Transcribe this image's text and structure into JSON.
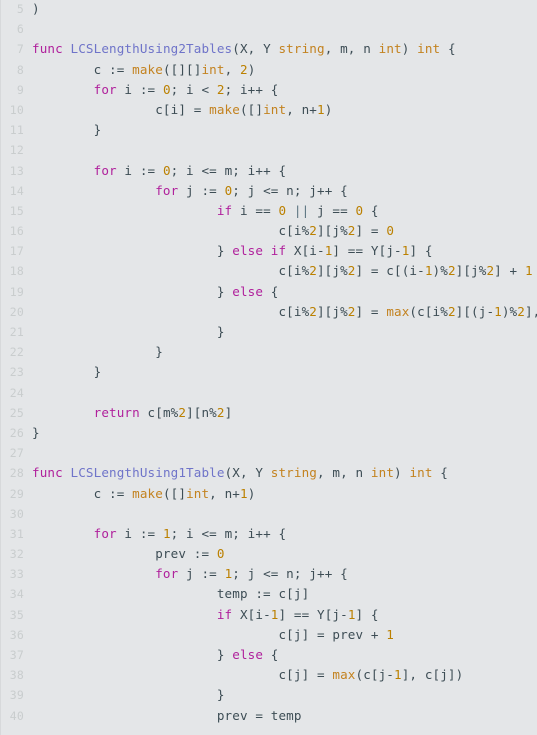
{
  "editor": {
    "language": "go",
    "background_color": "#e4e6e8",
    "gutter_color": "#c9cdce",
    "text_color": "#3d4d55",
    "first_visible_line": 5,
    "last_visible_line": 40,
    "theme_colors": {
      "keyword": "#b0219c",
      "function_name": "#6f74c9",
      "type_builtin": "#c3821f",
      "number": "#bb8000",
      "operator": "#5b7480",
      "plain": "#3d4d55"
    }
  },
  "lines": [
    {
      "number": "5",
      "tokens": [
        {
          "t": ")",
          "c": "t-pl"
        }
      ]
    },
    {
      "number": "6",
      "tokens": []
    },
    {
      "number": "7",
      "tokens": [
        {
          "t": "func ",
          "c": "t-kw"
        },
        {
          "t": "LCSLengthUsing2Tables",
          "c": "t-fn"
        },
        {
          "t": "(X, Y ",
          "c": "t-pl"
        },
        {
          "t": "string",
          "c": "t-type"
        },
        {
          "t": ", m, n ",
          "c": "t-pl"
        },
        {
          "t": "int",
          "c": "t-type"
        },
        {
          "t": ") ",
          "c": "t-pl"
        },
        {
          "t": "int",
          "c": "t-type"
        },
        {
          "t": " {",
          "c": "t-pl"
        }
      ]
    },
    {
      "number": "8",
      "tokens": [
        {
          "t": "        c := ",
          "c": "t-pl"
        },
        {
          "t": "make",
          "c": "t-type"
        },
        {
          "t": "([][]",
          "c": "t-pl"
        },
        {
          "t": "int",
          "c": "t-type"
        },
        {
          "t": ", ",
          "c": "t-pl"
        },
        {
          "t": "2",
          "c": "t-num"
        },
        {
          "t": ")",
          "c": "t-pl"
        }
      ]
    },
    {
      "number": "9",
      "tokens": [
        {
          "t": "        ",
          "c": "t-pl"
        },
        {
          "t": "for",
          "c": "t-kw"
        },
        {
          "t": " i := ",
          "c": "t-pl"
        },
        {
          "t": "0",
          "c": "t-num"
        },
        {
          "t": "; i < ",
          "c": "t-pl"
        },
        {
          "t": "2",
          "c": "t-num"
        },
        {
          "t": "; i++ {",
          "c": "t-pl"
        }
      ]
    },
    {
      "number": "10",
      "tokens": [
        {
          "t": "                c[i] = ",
          "c": "t-pl"
        },
        {
          "t": "make",
          "c": "t-type"
        },
        {
          "t": "([]",
          "c": "t-pl"
        },
        {
          "t": "int",
          "c": "t-type"
        },
        {
          "t": ", n+",
          "c": "t-pl"
        },
        {
          "t": "1",
          "c": "t-num"
        },
        {
          "t": ")",
          "c": "t-pl"
        }
      ]
    },
    {
      "number": "11",
      "tokens": [
        {
          "t": "        }",
          "c": "t-pl"
        }
      ]
    },
    {
      "number": "12",
      "tokens": []
    },
    {
      "number": "13",
      "tokens": [
        {
          "t": "        ",
          "c": "t-pl"
        },
        {
          "t": "for",
          "c": "t-kw"
        },
        {
          "t": " i := ",
          "c": "t-pl"
        },
        {
          "t": "0",
          "c": "t-num"
        },
        {
          "t": "; i <= m; i++ {",
          "c": "t-pl"
        }
      ]
    },
    {
      "number": "14",
      "tokens": [
        {
          "t": "                ",
          "c": "t-pl"
        },
        {
          "t": "for",
          "c": "t-kw"
        },
        {
          "t": " j := ",
          "c": "t-pl"
        },
        {
          "t": "0",
          "c": "t-num"
        },
        {
          "t": "; j <= n; j++ {",
          "c": "t-pl"
        }
      ]
    },
    {
      "number": "15",
      "tokens": [
        {
          "t": "                        ",
          "c": "t-pl"
        },
        {
          "t": "if",
          "c": "t-kw"
        },
        {
          "t": " i == ",
          "c": "t-pl"
        },
        {
          "t": "0",
          "c": "t-num"
        },
        {
          "t": " ",
          "c": "t-pl"
        },
        {
          "t": "||",
          "c": "t-op"
        },
        {
          "t": " j == ",
          "c": "t-pl"
        },
        {
          "t": "0",
          "c": "t-num"
        },
        {
          "t": " {",
          "c": "t-pl"
        }
      ]
    },
    {
      "number": "16",
      "tokens": [
        {
          "t": "                                c[i%",
          "c": "t-pl"
        },
        {
          "t": "2",
          "c": "t-num"
        },
        {
          "t": "][j%",
          "c": "t-pl"
        },
        {
          "t": "2",
          "c": "t-num"
        },
        {
          "t": "] = ",
          "c": "t-pl"
        },
        {
          "t": "0",
          "c": "t-num"
        }
      ]
    },
    {
      "number": "17",
      "tokens": [
        {
          "t": "                        } ",
          "c": "t-pl"
        },
        {
          "t": "else if",
          "c": "t-kw"
        },
        {
          "t": " X[i-",
          "c": "t-pl"
        },
        {
          "t": "1",
          "c": "t-num"
        },
        {
          "t": "] == Y[j-",
          "c": "t-pl"
        },
        {
          "t": "1",
          "c": "t-num"
        },
        {
          "t": "] {",
          "c": "t-pl"
        }
      ]
    },
    {
      "number": "18",
      "tokens": [
        {
          "t": "                                c[i%",
          "c": "t-pl"
        },
        {
          "t": "2",
          "c": "t-num"
        },
        {
          "t": "][j%",
          "c": "t-pl"
        },
        {
          "t": "2",
          "c": "t-num"
        },
        {
          "t": "] = c[(i-",
          "c": "t-pl"
        },
        {
          "t": "1",
          "c": "t-num"
        },
        {
          "t": ")%",
          "c": "t-pl"
        },
        {
          "t": "2",
          "c": "t-num"
        },
        {
          "t": "][j%",
          "c": "t-pl"
        },
        {
          "t": "2",
          "c": "t-num"
        },
        {
          "t": "] + ",
          "c": "t-pl"
        },
        {
          "t": "1",
          "c": "t-num"
        }
      ]
    },
    {
      "number": "19",
      "tokens": [
        {
          "t": "                        } ",
          "c": "t-pl"
        },
        {
          "t": "else",
          "c": "t-kw"
        },
        {
          "t": " {",
          "c": "t-pl"
        }
      ]
    },
    {
      "number": "20",
      "tokens": [
        {
          "t": "                                c[i%",
          "c": "t-pl"
        },
        {
          "t": "2",
          "c": "t-num"
        },
        {
          "t": "][j%",
          "c": "t-pl"
        },
        {
          "t": "2",
          "c": "t-num"
        },
        {
          "t": "] = ",
          "c": "t-pl"
        },
        {
          "t": "max",
          "c": "t-type"
        },
        {
          "t": "(c[i%",
          "c": "t-pl"
        },
        {
          "t": "2",
          "c": "t-num"
        },
        {
          "t": "][(j-",
          "c": "t-pl"
        },
        {
          "t": "1",
          "c": "t-num"
        },
        {
          "t": ")%",
          "c": "t-pl"
        },
        {
          "t": "2",
          "c": "t-num"
        },
        {
          "t": "], c[",
          "c": "t-pl"
        }
      ]
    },
    {
      "number": "21",
      "tokens": [
        {
          "t": "                        }",
          "c": "t-pl"
        }
      ]
    },
    {
      "number": "22",
      "tokens": [
        {
          "t": "                }",
          "c": "t-pl"
        }
      ]
    },
    {
      "number": "23",
      "tokens": [
        {
          "t": "        }",
          "c": "t-pl"
        }
      ]
    },
    {
      "number": "24",
      "tokens": []
    },
    {
      "number": "25",
      "tokens": [
        {
          "t": "        ",
          "c": "t-pl"
        },
        {
          "t": "return",
          "c": "t-kw"
        },
        {
          "t": " c[m%",
          "c": "t-pl"
        },
        {
          "t": "2",
          "c": "t-num"
        },
        {
          "t": "][n%",
          "c": "t-pl"
        },
        {
          "t": "2",
          "c": "t-num"
        },
        {
          "t": "]",
          "c": "t-pl"
        }
      ]
    },
    {
      "number": "26",
      "tokens": [
        {
          "t": "}",
          "c": "t-pl"
        }
      ]
    },
    {
      "number": "27",
      "tokens": []
    },
    {
      "number": "28",
      "tokens": [
        {
          "t": "func ",
          "c": "t-kw"
        },
        {
          "t": "LCSLengthUsing1Table",
          "c": "t-fn"
        },
        {
          "t": "(X, Y ",
          "c": "t-pl"
        },
        {
          "t": "string",
          "c": "t-type"
        },
        {
          "t": ", m, n ",
          "c": "t-pl"
        },
        {
          "t": "int",
          "c": "t-type"
        },
        {
          "t": ") ",
          "c": "t-pl"
        },
        {
          "t": "int",
          "c": "t-type"
        },
        {
          "t": " {",
          "c": "t-pl"
        }
      ]
    },
    {
      "number": "29",
      "tokens": [
        {
          "t": "        c := ",
          "c": "t-pl"
        },
        {
          "t": "make",
          "c": "t-type"
        },
        {
          "t": "([]",
          "c": "t-pl"
        },
        {
          "t": "int",
          "c": "t-type"
        },
        {
          "t": ", n+",
          "c": "t-pl"
        },
        {
          "t": "1",
          "c": "t-num"
        },
        {
          "t": ")",
          "c": "t-pl"
        }
      ]
    },
    {
      "number": "30",
      "tokens": []
    },
    {
      "number": "31",
      "tokens": [
        {
          "t": "        ",
          "c": "t-pl"
        },
        {
          "t": "for",
          "c": "t-kw"
        },
        {
          "t": " i := ",
          "c": "t-pl"
        },
        {
          "t": "1",
          "c": "t-num"
        },
        {
          "t": "; i <= m; i++ {",
          "c": "t-pl"
        }
      ]
    },
    {
      "number": "32",
      "tokens": [
        {
          "t": "                prev := ",
          "c": "t-pl"
        },
        {
          "t": "0",
          "c": "t-num"
        }
      ]
    },
    {
      "number": "33",
      "tokens": [
        {
          "t": "                ",
          "c": "t-pl"
        },
        {
          "t": "for",
          "c": "t-kw"
        },
        {
          "t": " j := ",
          "c": "t-pl"
        },
        {
          "t": "1",
          "c": "t-num"
        },
        {
          "t": "; j <= n; j++ {",
          "c": "t-pl"
        }
      ]
    },
    {
      "number": "34",
      "tokens": [
        {
          "t": "                        temp := c[j]",
          "c": "t-pl"
        }
      ]
    },
    {
      "number": "35",
      "tokens": [
        {
          "t": "                        ",
          "c": "t-pl"
        },
        {
          "t": "if",
          "c": "t-kw"
        },
        {
          "t": " X[i-",
          "c": "t-pl"
        },
        {
          "t": "1",
          "c": "t-num"
        },
        {
          "t": "] == Y[j-",
          "c": "t-pl"
        },
        {
          "t": "1",
          "c": "t-num"
        },
        {
          "t": "] {",
          "c": "t-pl"
        }
      ]
    },
    {
      "number": "36",
      "tokens": [
        {
          "t": "                                c[j] = prev + ",
          "c": "t-pl"
        },
        {
          "t": "1",
          "c": "t-num"
        }
      ]
    },
    {
      "number": "37",
      "tokens": [
        {
          "t": "                        } ",
          "c": "t-pl"
        },
        {
          "t": "else",
          "c": "t-kw"
        },
        {
          "t": " {",
          "c": "t-pl"
        }
      ]
    },
    {
      "number": "38",
      "tokens": [
        {
          "t": "                                c[j] = ",
          "c": "t-pl"
        },
        {
          "t": "max",
          "c": "t-type"
        },
        {
          "t": "(c[j-",
          "c": "t-pl"
        },
        {
          "t": "1",
          "c": "t-num"
        },
        {
          "t": "], c[j])",
          "c": "t-pl"
        }
      ]
    },
    {
      "number": "39",
      "tokens": [
        {
          "t": "                        }",
          "c": "t-pl"
        }
      ]
    },
    {
      "number": "40",
      "tokens": [
        {
          "t": "                        prev = temp",
          "c": "t-pl"
        }
      ]
    }
  ]
}
